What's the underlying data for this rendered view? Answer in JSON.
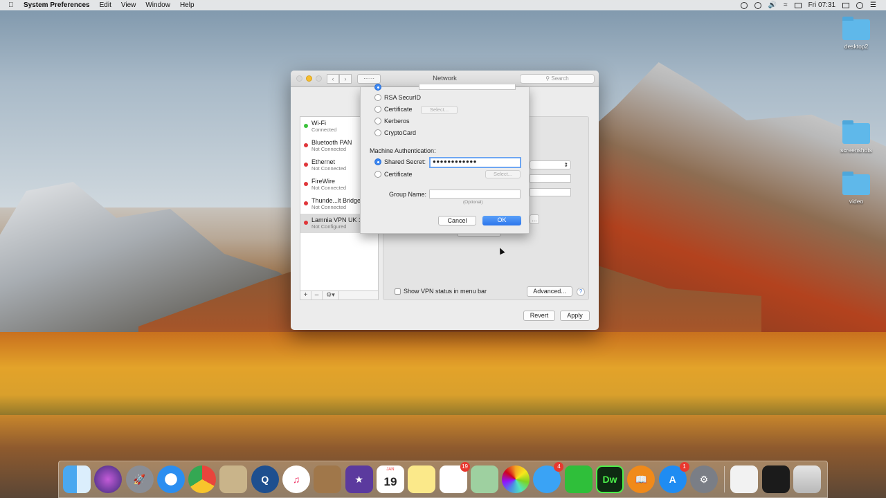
{
  "menubar": {
    "app": "System Preferences",
    "items": [
      "Edit",
      "View",
      "Window",
      "Help"
    ],
    "clock": "Fri 07:31"
  },
  "desktop": {
    "icons": [
      "desktop2",
      "screenshots",
      "video"
    ]
  },
  "window": {
    "title": "Network",
    "search_placeholder": "Search",
    "services": [
      {
        "name": "Wi-Fi",
        "status": "Connected",
        "color": "#3cc23c"
      },
      {
        "name": "Bluetooth PAN",
        "status": "Not Connected",
        "color": "#e0363a"
      },
      {
        "name": "Ethernet",
        "status": "Not Connected",
        "color": "#e0363a"
      },
      {
        "name": "FireWire",
        "status": "Not Connected",
        "color": "#e0363a"
      },
      {
        "name": "Thunde...lt Bridge",
        "status": "Not Connected",
        "color": "#e0363a"
      },
      {
        "name": "Lamnia VPN UK 1",
        "status": "Not Configured",
        "color": "#e0363a"
      }
    ],
    "show_vpn_status": "Show VPN status in menu bar",
    "advanced_label": "Advanced...",
    "help_label": "?",
    "revert_label": "Revert",
    "apply_label": "Apply",
    "partial_button_label": "..."
  },
  "sheet": {
    "user_auth_options": [
      {
        "label": "RSA SecurID",
        "selected": false
      },
      {
        "label": "Certificate",
        "selected": false
      },
      {
        "label": "Kerberos",
        "selected": false
      },
      {
        "label": "CryptoCard",
        "selected": false
      }
    ],
    "select_label": "Select...",
    "machine_auth_heading": "Machine Authentication:",
    "shared_secret_label": "Shared Secret:",
    "shared_secret_value": "●●●●●●●●●●●●",
    "certificate_label": "Certificate",
    "machine_select_label": "Select...",
    "group_name_label": "Group Name:",
    "group_name_value": "",
    "optional_hint": "(Optional)",
    "cancel_label": "Cancel",
    "ok_label": "OK"
  },
  "dock": {
    "calendar_month": "JAN",
    "calendar_day": "19",
    "reminders_badge": "19",
    "messages_badge": "4",
    "appstore_badge": "1",
    "dreamweaver_label": "Dw",
    "items": [
      "finder-icon",
      "siri-icon",
      "launchpad-icon",
      "safari-icon",
      "chrome-icon",
      "mail-icon",
      "quicktime-icon",
      "itunes-icon",
      "notefile-icon",
      "imovie-icon",
      "calendar-icon",
      "notes-icon",
      "reminders-icon",
      "maps-icon",
      "photos-icon",
      "messages-icon",
      "facetime-icon",
      "dreamweaver-icon",
      "ibooks-icon",
      "appstore-icon",
      "system-preferences-icon",
      "document-icon",
      "screen-capture-icon",
      "trash-icon"
    ]
  }
}
